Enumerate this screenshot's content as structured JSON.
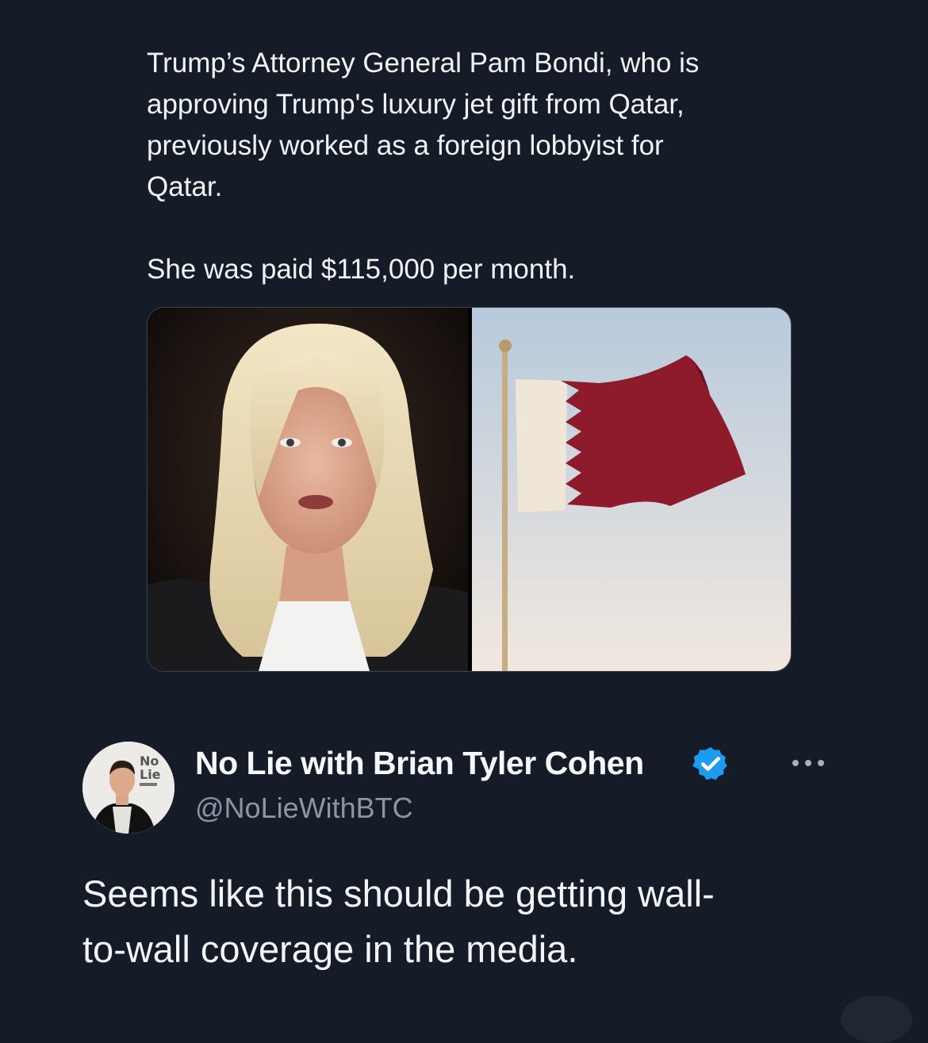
{
  "quoted_post": {
    "paragraph_1": "Trump’s Attorney General Pam Bondi, who is\napproving Trump's luxury jet gift from Qatar,\npreviously worked as a foreign lobbyist for\nQatar.",
    "paragraph_2": "She was paid $115,000 per month.",
    "images": [
      "portrait-photo",
      "qatar-flag-photo"
    ]
  },
  "post": {
    "avatar_text_top": "No",
    "avatar_text_bottom": "Lie",
    "display_name": "No Lie with Brian Tyler Cohen",
    "verified": true,
    "handle": "@NoLieWithBTC",
    "body": "Seems like this should be getting wall-\nto-wall coverage in the media.",
    "more_icon": "ellipsis-icon"
  },
  "colors": {
    "background": "#151c28",
    "verified_blue": "#1d9bf0",
    "handle_gray": "#8b96a4",
    "flag_maroon": "#8d1b2b"
  }
}
